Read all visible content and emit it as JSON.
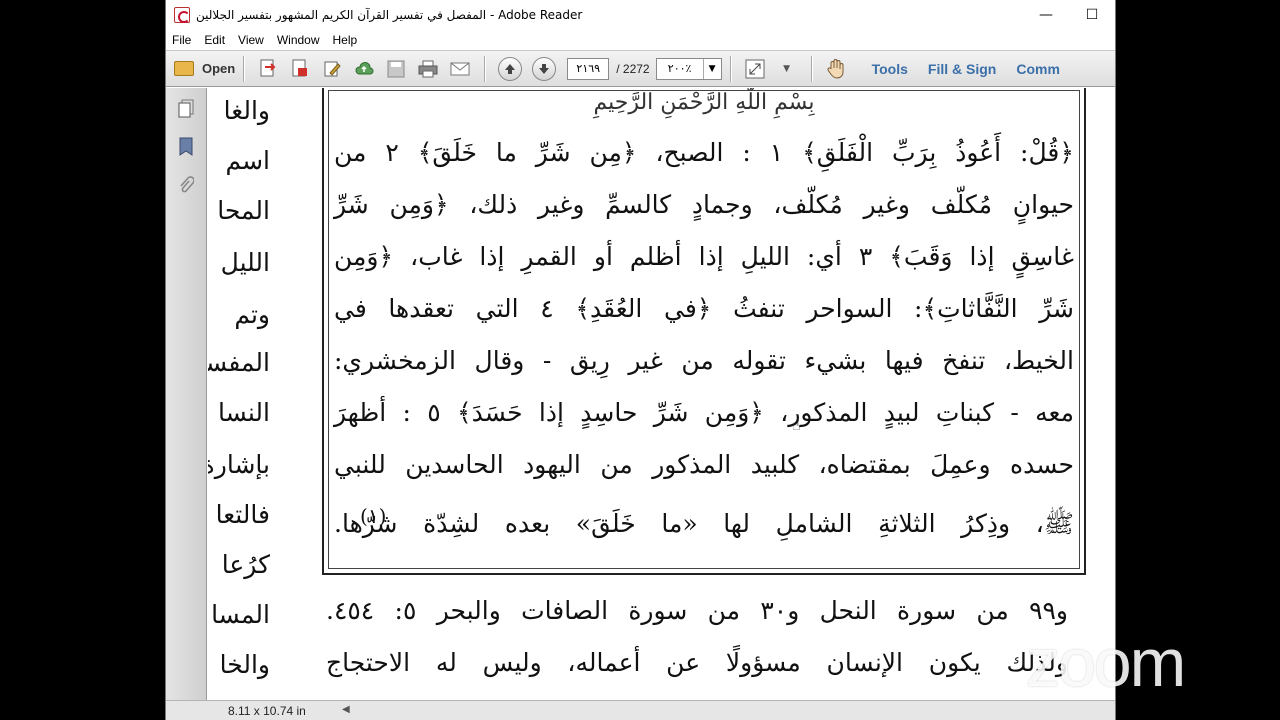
{
  "window": {
    "title": "المفصل في تفسير القرآن الكريم المشهور بتفسير الجلالين - Adobe Reader",
    "minimize_glyph": "—",
    "maximize_glyph": "☐"
  },
  "menu": [
    "File",
    "Edit",
    "View",
    "Window",
    "Help"
  ],
  "toolbar": {
    "open_label": "Open",
    "page_current": "٢١٦٩",
    "page_total": "/ 2272",
    "zoom": "٢٠٠٪",
    "tools_label": "Tools",
    "fill_sign_label": "Fill & Sign",
    "comment_label": "Comm"
  },
  "status": {
    "page_size": "8.11 x 10.74 in"
  },
  "document": {
    "basmala": "بِسْمِ اللَّهِ الرَّحْمَنِ الرَّحِيمِ",
    "left_column": [
      "والغا",
      "اسم",
      "المحا",
      "الليل",
      "وتم",
      "المفسا",
      "النسا",
      "بإشارة",
      "فالتعا",
      "كرُعا",
      "المسا",
      "والخا"
    ],
    "boxed_lines": [
      "﴿قُلْ: أَعُوذُ بِرَبِّ الْفَلَقِ﴾ ١ : الصبح، ﴿مِن شَرِّ ما خَلَقَ﴾ ٢ من",
      "حيوانٍ مُكلّف وغير مُكلّف، وجمادٍ كالسمِّ وغير ذلك، ﴿وَمِن شَرِّ",
      "غاسِقٍ إذا وَقَبَ﴾ ٣ أي: الليلِ إذا أظلم أو القمرِ إذا غاب، ﴿وَمِن",
      "شَرِّ النَّفَّاثاتِ﴾: السواحر تنفثُ ﴿في العُقَدِ﴾ ٤ التي تعقدها في",
      "الخيط، تنفخ فيها بشيء تقوله من غير رِيق - وقال الزمخشري:",
      "معه - كبناتِ لبيدٍ المذكور، ﴿وَمِن شَرِّ حاسِدٍ إذا حَسَدَ﴾ ٥ : أظهرَ",
      "حسده وعمِلَ بمقتضاه، كلبيد المذكور من اليهود الحاسدين للنبي",
      "ﷺ، وذِكرُ الثلاثةِ الشاملِ لها «ما خَلَقَ» بعده لشِدّة شرّها."
    ],
    "footnote_mark": "(١)",
    "body_lines": [
      "و٩٩ من سورة النحل و٣٠ من سورة الصافات والبحر ٥: ٤٥٤.",
      "ولذلك يكون الإنسان مسؤولًا عن أعماله، وليس له الاحتجاج"
    ]
  },
  "overlay": {
    "zoom_watermark": "zoom"
  }
}
